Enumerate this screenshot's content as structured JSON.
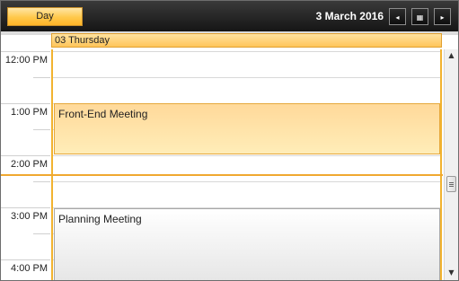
{
  "toolbar": {
    "view_label": "Day",
    "date_title": "3 March 2016",
    "prev_icon": "◂",
    "calendar_icon": "▦",
    "next_icon": "▸"
  },
  "day_header": {
    "label": "03 Thursday"
  },
  "time_labels": [
    "12:00 PM",
    "1:00 PM",
    "2:00 PM",
    "3:00 PM",
    "4:00 PM"
  ],
  "appointments": [
    {
      "subject": "Front-End Meeting",
      "color": "#ffd99a"
    },
    {
      "subject": "Planning Meeting",
      "color": "#e6e6e6"
    }
  ],
  "scrollbar": {
    "up_icon": "▲",
    "down_icon": "▼"
  },
  "colors": {
    "accent": "#f2b330",
    "toolbar_bg": "#151515"
  }
}
